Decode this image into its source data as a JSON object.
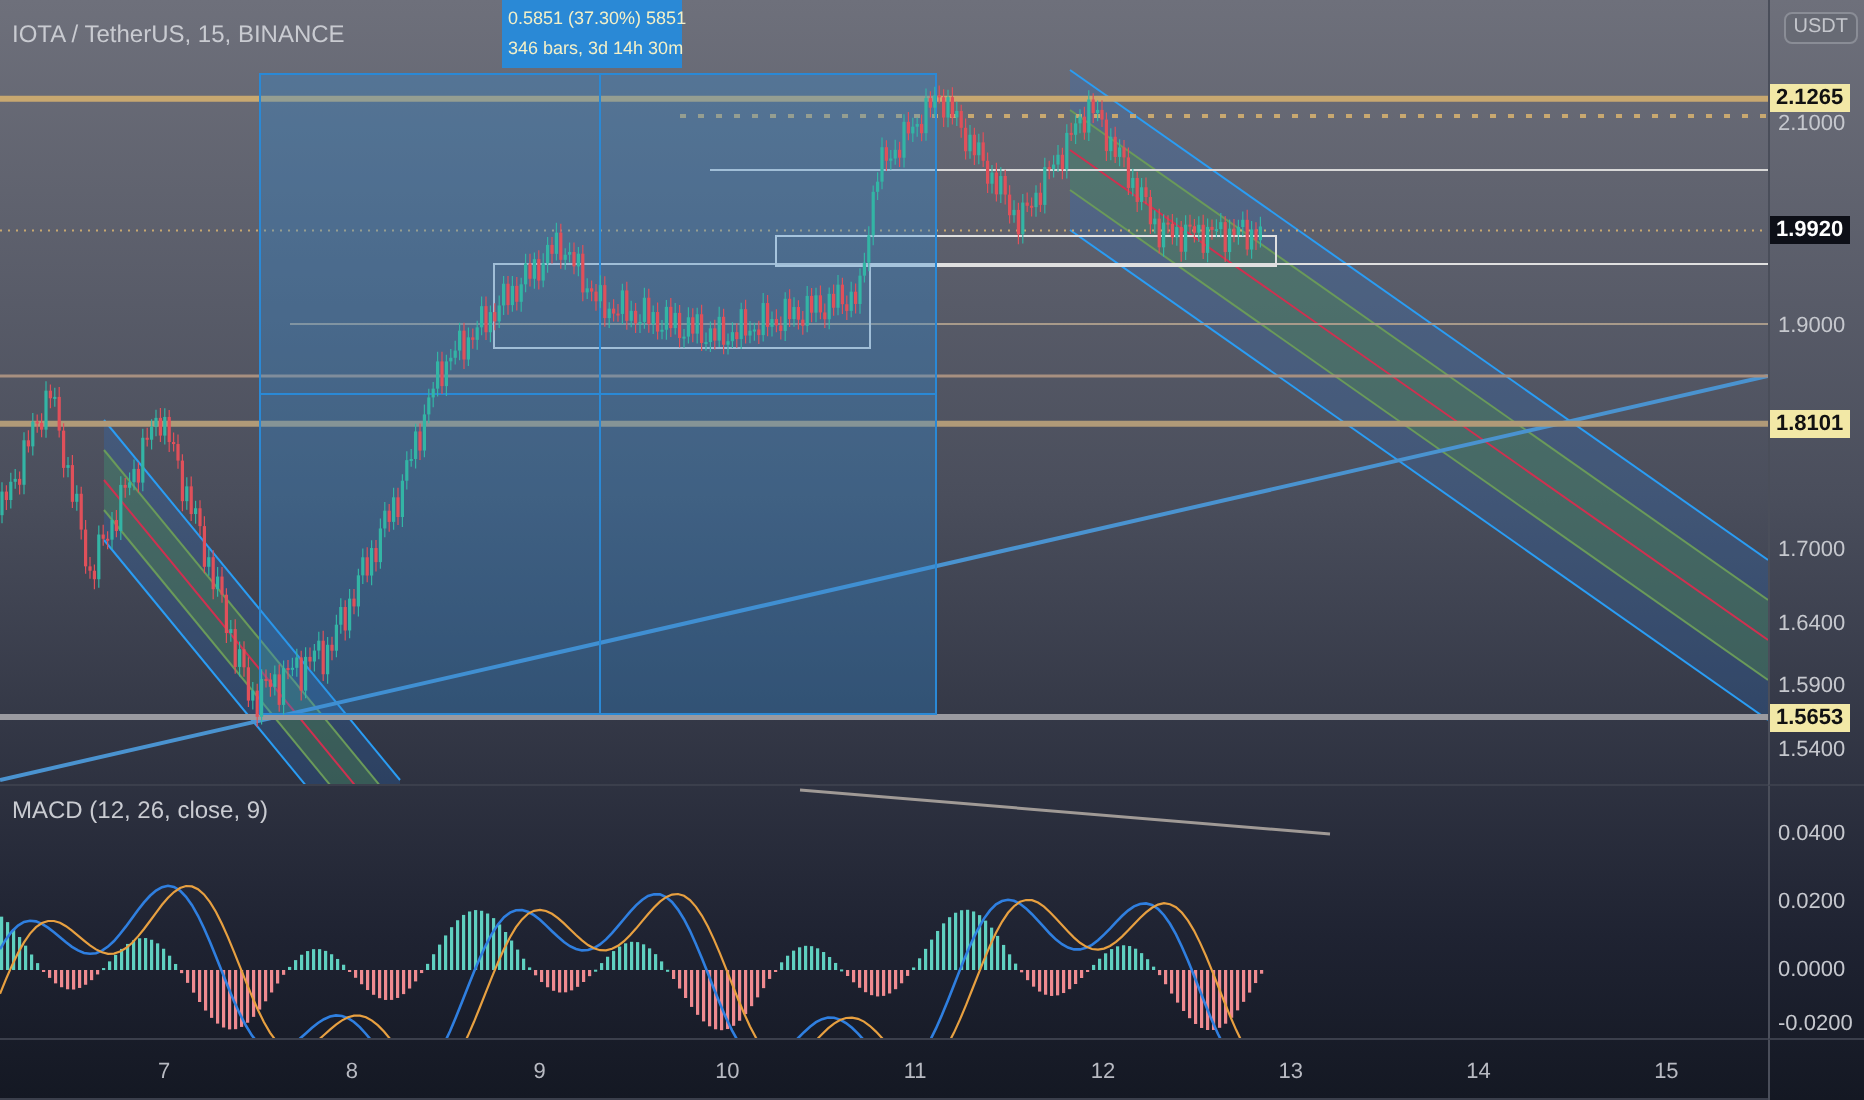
{
  "symbol_title": "IOTA / TetherUS, 15, BINANCE",
  "measure_tooltip": [
    "0.5851 (37.30%) 5851",
    "346 bars, 3d 14h 30m"
  ],
  "currency_button": "USDT",
  "price_axis": [
    {
      "label": "2.1265",
      "kind": "marker",
      "color": "#f2e8a6"
    },
    {
      "label": "2.1000",
      "kind": "tick"
    },
    {
      "label": "1.9920",
      "kind": "marker",
      "color": "#0d0f17"
    },
    {
      "label": "1.9000",
      "kind": "tick"
    },
    {
      "label": "1.8101",
      "kind": "marker",
      "color": "#f2e8a6"
    },
    {
      "label": "1.7000",
      "kind": "tick"
    },
    {
      "label": "1.6400",
      "kind": "tick"
    },
    {
      "label": "1.5900",
      "kind": "tick"
    },
    {
      "label": "1.5653",
      "kind": "marker",
      "color": "#f2e8a6"
    },
    {
      "label": "1.5400",
      "kind": "tick"
    }
  ],
  "macd_title": "MACD (12, 26, close, 9)",
  "macd_axis": [
    "0.0400",
    "0.0200",
    "0.0000",
    "-0.0200"
  ],
  "time_axis": [
    "7",
    "8",
    "9",
    "10",
    "11",
    "12",
    "13",
    "14",
    "15"
  ]
}
